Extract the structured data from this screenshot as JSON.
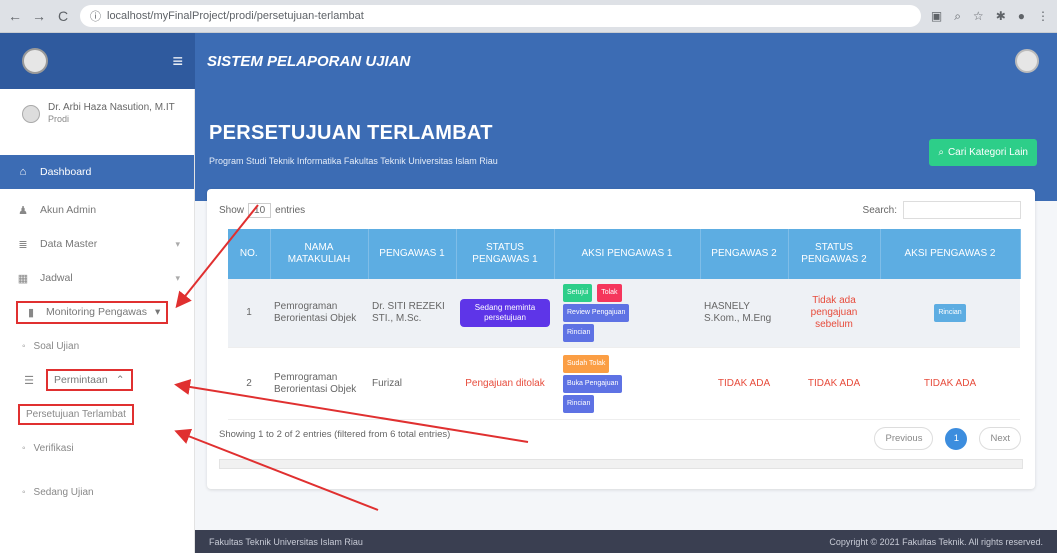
{
  "browser": {
    "url": "localhost/myFinalProject/prodi/persetujuan-terlambat",
    "nav": {
      "back": "←",
      "forward": "→",
      "reload": "C",
      "info": "ⓘ"
    }
  },
  "header": {
    "app_title": "SISTEM PELAPORAN UJIAN"
  },
  "sidebar": {
    "user": {
      "name": "Dr. Arbi Haza Nasution, M.IT",
      "role": "Prodi"
    },
    "items": [
      {
        "label": "Dashboard",
        "icon": "home-icon"
      },
      {
        "label": "Akun Admin",
        "icon": "user-icon"
      },
      {
        "label": "Data Master",
        "icon": "database-icon"
      },
      {
        "label": "Jadwal",
        "icon": "calendar-icon"
      },
      {
        "label": "Monitoring Pengawas",
        "icon": "book-icon"
      }
    ],
    "sub_soal": "Soal Ujian",
    "permintaan": "Permintaan",
    "sub_items": [
      "Persetujuan Terlambat",
      "Verifikasi",
      "Sedang Ujian"
    ]
  },
  "page": {
    "title": "PERSETUJUAN TERLAMBAT",
    "subtitle": "Program Studi Teknik Informatika Fakultas Teknik Universitas Islam Riau",
    "button_cari": "Cari Kategori Lain"
  },
  "table": {
    "show_label": "Show",
    "show_value": "10",
    "entries_label": "entries",
    "search_label": "Search:",
    "headers": [
      "NO.",
      "NAMA MATAKULIAH",
      "PENGAWAS 1",
      "STATUS PENGAWAS 1",
      "AKSI PENGAWAS 1",
      "PENGAWAS 2",
      "STATUS PENGAWAS 2",
      "AKSI PENGAWAS 2"
    ],
    "rows": [
      {
        "no": "1",
        "matkul": "Pemrograman Berorientasi Objek",
        "pengawas1": "Dr. SITI REZEKI STI., M.Sc.",
        "status1": "Sedang meminta persetujuan",
        "aksi1": [
          "Setujui",
          "Tolak",
          "Review Pengajuan",
          "Rincian"
        ],
        "pengawas2": "HASNELY S.Kom., M.Eng",
        "status2": "Tidak ada pengajuan sebelum",
        "aksi2": "Rincian"
      },
      {
        "no": "2",
        "matkul": "Pemrograman Berorientasi Objek",
        "pengawas1": "Furizal",
        "status1": "Pengajuan ditolak",
        "aksi1": [
          "Sudah Tolak",
          "Buka Pengajuan",
          "Rincian"
        ],
        "pengawas2": "TIDAK ADA",
        "status2": "TIDAK ADA",
        "aksi2": "TIDAK ADA"
      }
    ],
    "info": "Showing 1 to 2 of 2 entries (filtered from 6 total entries)",
    "prev": "Previous",
    "page": "1",
    "next": "Next"
  },
  "footer": {
    "left": "Fakultas Teknik Universitas Islam Riau",
    "right": "Copyright © 2021 Fakultas Teknik. All rights reserved."
  }
}
